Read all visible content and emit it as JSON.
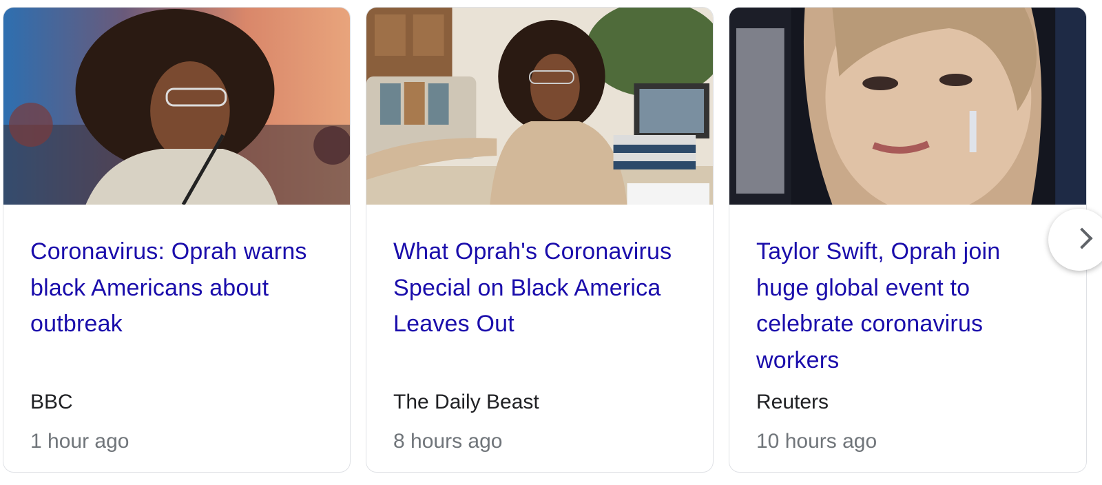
{
  "news_cards": [
    {
      "headline": "Coronavirus: Oprah warns black Americans about outbreak",
      "source": "BBC",
      "time": "1 hour ago",
      "thumbnail": "photo of woman with curly hair and glasses at microphone"
    },
    {
      "headline": "What Oprah's Coronavirus Special on Black America Leaves Out",
      "source": "The Daily Beast",
      "time": "8 hours ago",
      "thumbnail": "photo of woman seated in living room with laptop"
    },
    {
      "headline": "Taylor Swift, Oprah join huge global event to celebrate coronavirus workers",
      "source": "Reuters",
      "time": "10 hours ago",
      "thumbnail": "close-up photo of blonde woman with earrings"
    }
  ],
  "next_button": {
    "icon": "chevron-right-icon"
  },
  "colors": {
    "headline": "#1a0dab",
    "source": "#202124",
    "time": "#70757a",
    "border": "#dfe1e5"
  }
}
